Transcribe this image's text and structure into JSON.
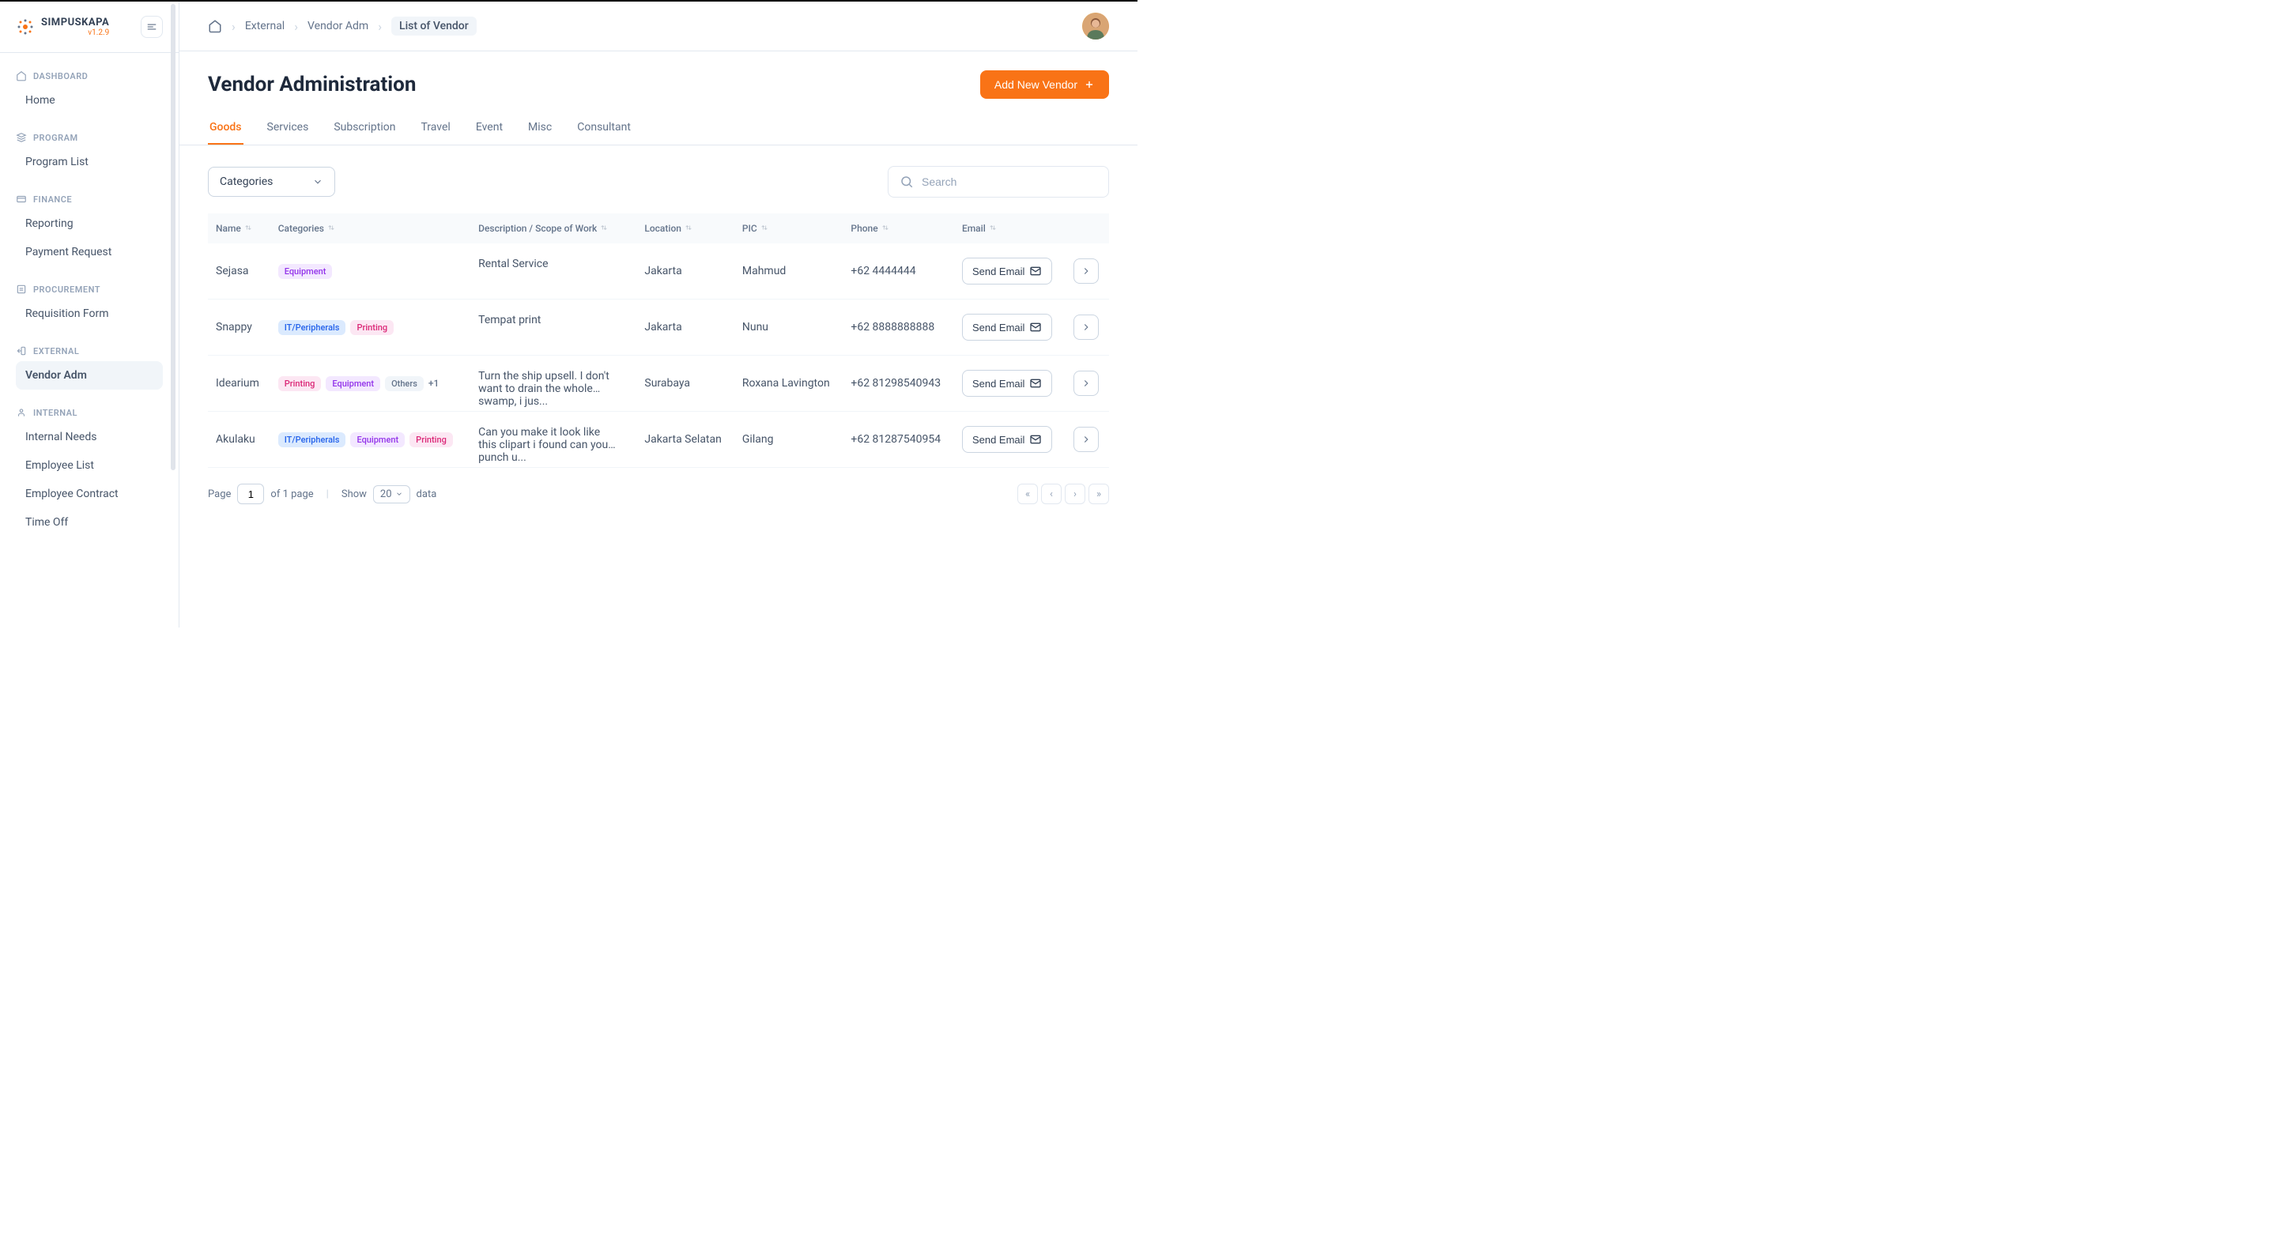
{
  "brand": {
    "name": "SIMPUSKAPA",
    "version": "v1.2.9"
  },
  "sidebar": {
    "sections": [
      {
        "heading": "DASHBOARD",
        "items": [
          "Home"
        ]
      },
      {
        "heading": "PROGRAM",
        "items": [
          "Program List"
        ]
      },
      {
        "heading": "FINANCE",
        "items": [
          "Reporting",
          "Payment Request"
        ]
      },
      {
        "heading": "PROCUREMENT",
        "items": [
          "Requisition Form"
        ]
      },
      {
        "heading": "EXTERNAL",
        "items": [
          "Vendor Adm"
        ],
        "activeIndex": 0
      },
      {
        "heading": "INTERNAL",
        "items": [
          "Internal Needs",
          "Employee List",
          "Employee Contract",
          "Time Off"
        ]
      }
    ]
  },
  "breadcrumb": {
    "items": [
      "External",
      "Vendor Adm",
      "List of Vendor"
    ]
  },
  "page": {
    "title": "Vendor Administration",
    "primaryButton": "Add New Vendor"
  },
  "tabs": [
    "Goods",
    "Services",
    "Subscription",
    "Travel",
    "Event",
    "Misc",
    "Consultant"
  ],
  "activeTab": "Goods",
  "filter": {
    "categoriesLabel": "Categories",
    "searchPlaceholder": "Search"
  },
  "table": {
    "columns": [
      "Name",
      "Categories",
      "Description / Scope of Work",
      "Location",
      "PIC",
      "Phone",
      "Email"
    ],
    "sendEmailLabel": "Send Email",
    "rows": [
      {
        "name": "Sejasa",
        "categories": [
          {
            "label": "Equipment",
            "cls": "equipment"
          }
        ],
        "desc": "Rental Service",
        "location": "Jakarta",
        "pic": "Mahmud",
        "phone": "+62 4444444"
      },
      {
        "name": "Snappy",
        "categories": [
          {
            "label": "IT/Peripherals",
            "cls": "it"
          },
          {
            "label": "Printing",
            "cls": "printing"
          }
        ],
        "desc": "Tempat print",
        "location": "Jakarta",
        "pic": "Nunu",
        "phone": "+62 8888888888"
      },
      {
        "name": "Idearium",
        "categories": [
          {
            "label": "Printing",
            "cls": "printing"
          },
          {
            "label": "Equipment",
            "cls": "equipment"
          },
          {
            "label": "Others",
            "cls": "others"
          }
        ],
        "extra": "+1",
        "desc": "Turn the ship upsell. I don't want to drain the whole swamp, i jus...",
        "location": "Surabaya",
        "pic": "Roxana Lavington",
        "phone": "+62 81298540943"
      },
      {
        "name": "Akulaku",
        "categories": [
          {
            "label": "IT/Peripherals",
            "cls": "it"
          },
          {
            "label": "Equipment",
            "cls": "equipment"
          },
          {
            "label": "Printing",
            "cls": "printing"
          }
        ],
        "desc": "Can you make it look like this clipart i found can you punch u...",
        "location": "Jakarta Selatan",
        "pic": "Gilang",
        "phone": "+62 81287540954"
      }
    ]
  },
  "pagination": {
    "pageLabel": "Page",
    "pageValue": "1",
    "ofLabel": "of 1 page",
    "showLabel": "Show",
    "showValue": "20",
    "dataLabel": "data"
  }
}
